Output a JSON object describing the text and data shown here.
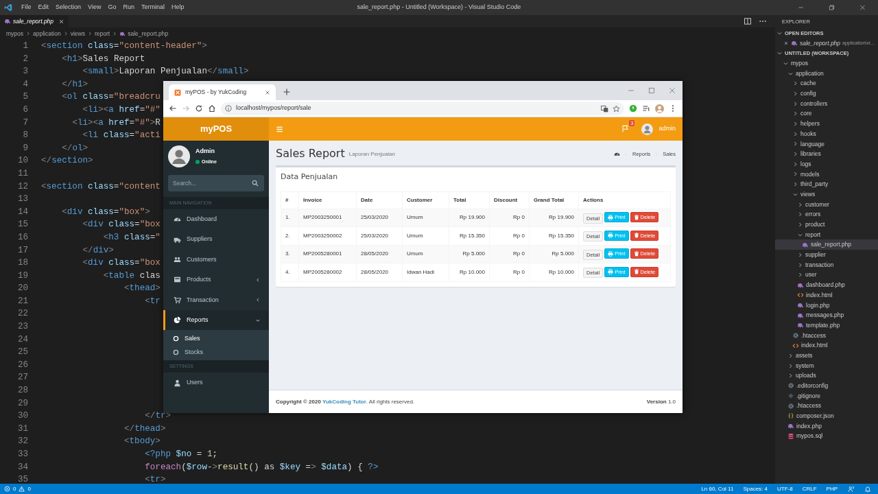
{
  "vscode": {
    "title": "sale_report.php - Untitled (Workspace) - Visual Studio Code",
    "menu": [
      "File",
      "Edit",
      "Selection",
      "View",
      "Go",
      "Run",
      "Terminal",
      "Help"
    ],
    "tabs": [
      {
        "label": "sale_report.php",
        "selected": true
      }
    ],
    "breadcrumb": [
      "mypos",
      "application",
      "views",
      "report",
      "sale_report.php"
    ],
    "code_lines": [
      {
        "number": "1",
        "text": "<section class=\"content-header\">"
      },
      {
        "number": "2",
        "text": "    <h1>Sales Report"
      },
      {
        "number": "3",
        "text": "        <small>Laporan Penjualan</small>"
      },
      {
        "number": "4",
        "text": "    </h1>"
      },
      {
        "number": "5",
        "text": "    <ol class=\"breadcru"
      },
      {
        "number": "6",
        "text": "        <li><a href=\"#\""
      },
      {
        "number": "7",
        "text": "      <li><a href=\"#\">R"
      },
      {
        "number": "8",
        "text": "        <li class=\"acti"
      },
      {
        "number": "9",
        "text": "    </ol>"
      },
      {
        "number": "10",
        "text": "</section>"
      },
      {
        "number": "11"
      },
      {
        "number": "12",
        "text": "<section class=\"content"
      },
      {
        "number": "13"
      },
      {
        "number": "14",
        "text": "    <div class=\"box\">"
      },
      {
        "number": "15",
        "text": "        <div class=\"box"
      },
      {
        "number": "16",
        "text": "            <h3 class=\""
      },
      {
        "number": "17",
        "text": "        </div>"
      },
      {
        "number": "18",
        "text": "        <div class=\"box"
      },
      {
        "number": "19",
        "text": "            <table clas"
      },
      {
        "number": "20",
        "text": "                <thead>"
      },
      {
        "number": "21",
        "text": "                    <tr"
      },
      {
        "number": "22"
      },
      {
        "number": "23"
      },
      {
        "number": "24"
      },
      {
        "number": "25"
      },
      {
        "number": "26"
      },
      {
        "number": "27"
      },
      {
        "number": "28"
      },
      {
        "number": "29"
      },
      {
        "number": "30",
        "text": "                    </tr>"
      },
      {
        "number": "31",
        "text": "                </thead>"
      },
      {
        "number": "32",
        "text": "                <tbody>"
      },
      {
        "number": "33",
        "text": "                    <?php $no = 1;"
      },
      {
        "number": "34",
        "text": "                    foreach($row->result() as $key => $data) { ?>"
      },
      {
        "number": "35",
        "text": "                    <tr>"
      }
    ],
    "explorer": {
      "title": "EXPLORER",
      "open_editors": {
        "label": "OPEN EDITORS",
        "expanded": true,
        "items": [
          {
            "name": "sale_report.php",
            "path": "application\\vi...",
            "kind": "php",
            "selected": false
          }
        ]
      },
      "workspace": {
        "label": "UNTITLED (WORKSPACE)",
        "expanded": true,
        "tree": [
          {
            "name": "mypos",
            "kind": "folder",
            "expanded": true,
            "selected": false,
            "children": [
              {
                "name": "application",
                "kind": "folder",
                "expanded": true,
                "selected": false,
                "children": [
                  {
                    "name": "cache",
                    "kind": "folder",
                    "expanded": false,
                    "selected": false
                  },
                  {
                    "name": "config",
                    "kind": "folder",
                    "expanded": false,
                    "selected": false
                  },
                  {
                    "name": "controllers",
                    "kind": "folder",
                    "expanded": false,
                    "selected": false
                  },
                  {
                    "name": "core",
                    "kind": "folder",
                    "expanded": false,
                    "selected": false
                  },
                  {
                    "name": "helpers",
                    "kind": "folder",
                    "expanded": false,
                    "selected": false
                  },
                  {
                    "name": "hooks",
                    "kind": "folder",
                    "expanded": false,
                    "selected": false
                  },
                  {
                    "name": "language",
                    "kind": "folder",
                    "expanded": false,
                    "selected": false
                  },
                  {
                    "name": "libraries",
                    "kind": "folder",
                    "expanded": false,
                    "selected": false
                  },
                  {
                    "name": "logs",
                    "kind": "folder",
                    "expanded": false,
                    "selected": false
                  },
                  {
                    "name": "models",
                    "kind": "folder",
                    "expanded": false,
                    "selected": false
                  },
                  {
                    "name": "third_party",
                    "kind": "folder",
                    "expanded": false,
                    "selected": false
                  },
                  {
                    "name": "views",
                    "kind": "folder",
                    "expanded": true,
                    "selected": false,
                    "children": [
                      {
                        "name": "customer",
                        "kind": "folder",
                        "expanded": false,
                        "selected": false
                      },
                      {
                        "name": "errors",
                        "kind": "folder",
                        "expanded": false,
                        "selected": false
                      },
                      {
                        "name": "product",
                        "kind": "folder",
                        "expanded": false,
                        "selected": false
                      },
                      {
                        "name": "report",
                        "kind": "folder",
                        "expanded": true,
                        "selected": false,
                        "children": [
                          {
                            "name": "sale_report.php",
                            "kind": "php",
                            "selected": true
                          }
                        ]
                      },
                      {
                        "name": "supplier",
                        "kind": "folder",
                        "expanded": false,
                        "selected": false
                      },
                      {
                        "name": "transaction",
                        "kind": "folder",
                        "expanded": false,
                        "selected": false
                      },
                      {
                        "name": "user",
                        "kind": "folder",
                        "expanded": false,
                        "selected": false
                      },
                      {
                        "name": "dashboard.php",
                        "kind": "php",
                        "selected": false
                      },
                      {
                        "name": "index.html",
                        "kind": "html",
                        "selected": false
                      },
                      {
                        "name": "login.php",
                        "kind": "php",
                        "selected": false
                      },
                      {
                        "name": "messages.php",
                        "kind": "php",
                        "selected": false
                      },
                      {
                        "name": "template.php",
                        "kind": "php",
                        "selected": false
                      }
                    ]
                  },
                  {
                    "name": ".htaccess",
                    "kind": "config",
                    "selected": false
                  },
                  {
                    "name": "index.html",
                    "kind": "html",
                    "selected": false
                  }
                ]
              },
              {
                "name": "assets",
                "kind": "folder",
                "expanded": false,
                "selected": false
              },
              {
                "name": "system",
                "kind": "folder",
                "expanded": false,
                "selected": false
              },
              {
                "name": "uploads",
                "kind": "folder",
                "expanded": false,
                "selected": false
              },
              {
                "name": ".editorconfig",
                "kind": "config",
                "selected": false
              },
              {
                "name": ".gitignore",
                "kind": "git",
                "selected": false
              },
              {
                "name": ".htaccess",
                "kind": "config",
                "selected": false
              },
              {
                "name": "composer.json",
                "kind": "json",
                "selected": false
              },
              {
                "name": "index.php",
                "kind": "php",
                "selected": false
              },
              {
                "name": "mypos.sql",
                "kind": "sql",
                "selected": false
              }
            ]
          }
        ]
      }
    },
    "status_bar": {
      "errors": "0",
      "warnings": "0",
      "items": [
        "Ln 60, Col 11",
        "Spaces: 4",
        "UTF-8",
        "CRLF",
        "PHP"
      ]
    }
  },
  "browser": {
    "tab_title": "myPOS - by YukCoding",
    "url": "localhost/mypos/report/sale",
    "app": {
      "logo": "myPOS",
      "notifications": "3",
      "user": "admin",
      "sidebar": {
        "user_name": "Admin",
        "status": "Online",
        "search_placeholder": "Search...",
        "sections": [
          {
            "header": "MAIN NAVIGATION",
            "items": [
              {
                "label": "Dashboard",
                "expandable": false,
                "selected": false
              },
              {
                "label": "Suppliers",
                "expandable": false,
                "selected": false
              },
              {
                "label": "Customers",
                "expandable": false,
                "selected": false
              },
              {
                "label": "Products",
                "expandable": true,
                "expanded": false,
                "selected": false
              },
              {
                "label": "Transaction",
                "expandable": true,
                "expanded": false,
                "selected": false
              },
              {
                "label": "Reports",
                "expandable": true,
                "expanded": true,
                "selected": true,
                "children": [
                  {
                    "label": "Sales",
                    "selected": true
                  },
                  {
                    "label": "Stocks",
                    "selected": false
                  }
                ]
              }
            ]
          },
          {
            "header": "SETTINGS",
            "items": [
              {
                "label": "Users",
                "expandable": false,
                "selected": false
              }
            ]
          }
        ]
      },
      "page_title": "Sales Report",
      "page_subtitle": "Laporan Penjualan",
      "breadcrumb": [
        "Reports",
        "Sales"
      ],
      "box_title": "Data Penjualan",
      "table": {
        "columns": [
          "#",
          "Invoice",
          "Date",
          "Customer",
          "Total",
          "Discount",
          "Grand Total",
          "Actions"
        ],
        "rows": [
          {
            "cells": [
              "1.",
              "MP2003250001",
              "25/03/2020",
              "Umum",
              "Rp 19.900",
              "Rp 0",
              "Rp 19.900"
            ],
            "actions": [
              {
                "label": "Detail",
                "kind": "default"
              },
              {
                "label": "Print",
                "kind": "print"
              },
              {
                "label": "Delete",
                "kind": "delete"
              }
            ]
          },
          {
            "cells": [
              "2.",
              "MP2003250002",
              "25/03/2020",
              "Umum",
              "Rp 15.350",
              "Rp 0",
              "Rp 15.350"
            ],
            "actions": [
              {
                "label": "Detail",
                "kind": "default"
              },
              {
                "label": "Print",
                "kind": "print"
              },
              {
                "label": "Delete",
                "kind": "delete"
              }
            ]
          },
          {
            "cells": [
              "3.",
              "MP2005280001",
              "28/05/2020",
              "Umum",
              "Rp 5.000",
              "Rp 0",
              "Rp 5.000"
            ],
            "actions": [
              {
                "label": "Detail",
                "kind": "default"
              },
              {
                "label": "Print",
                "kind": "print"
              },
              {
                "label": "Delete",
                "kind": "delete"
              }
            ]
          },
          {
            "cells": [
              "4.",
              "MP2005280002",
              "28/05/2020",
              "Idwan Hadi",
              "Rp 10.000",
              "Rp 0",
              "Rp 10.000"
            ],
            "actions": [
              {
                "label": "Detail",
                "kind": "default"
              },
              {
                "label": "Print",
                "kind": "print"
              },
              {
                "label": "Delete",
                "kind": "delete"
              }
            ]
          }
        ]
      },
      "footer": {
        "before": "Copyright © 2020",
        "link": "YukCoding Tutor",
        "after": ". All rights reserved.",
        "version_label": "Version",
        "version": "1.0"
      }
    }
  }
}
